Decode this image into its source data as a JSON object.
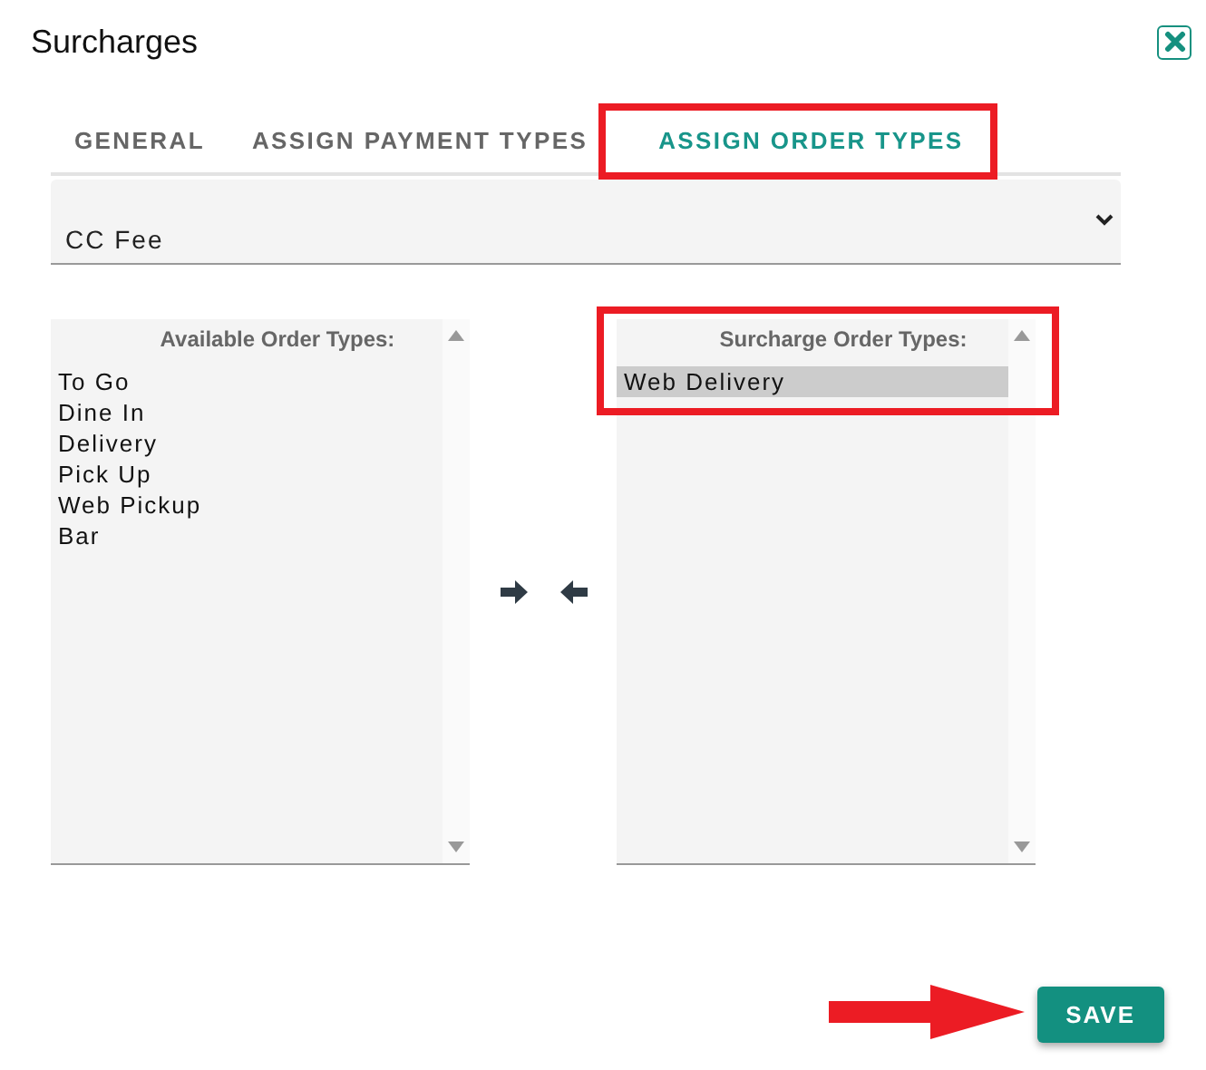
{
  "dialog": {
    "title": "Surcharges"
  },
  "tabs": [
    {
      "label": "GENERAL",
      "selected": false
    },
    {
      "label": "ASSIGN PAYMENT TYPES",
      "selected": false
    },
    {
      "label": "ASSIGN ORDER TYPES",
      "selected": true
    }
  ],
  "surcharge_select": {
    "value": "CC Fee"
  },
  "available_list": {
    "heading": "Available Order Types:",
    "items": [
      {
        "label": "To Go",
        "selected": false
      },
      {
        "label": "Dine In",
        "selected": false
      },
      {
        "label": "Delivery",
        "selected": false
      },
      {
        "label": "Pick Up",
        "selected": false
      },
      {
        "label": "Web Pickup",
        "selected": false
      },
      {
        "label": "Bar",
        "selected": false
      }
    ]
  },
  "surcharge_list": {
    "heading": "Surcharge Order Types:",
    "items": [
      {
        "label": "Web Delivery",
        "selected": true
      }
    ]
  },
  "save_button": "SAVE"
}
